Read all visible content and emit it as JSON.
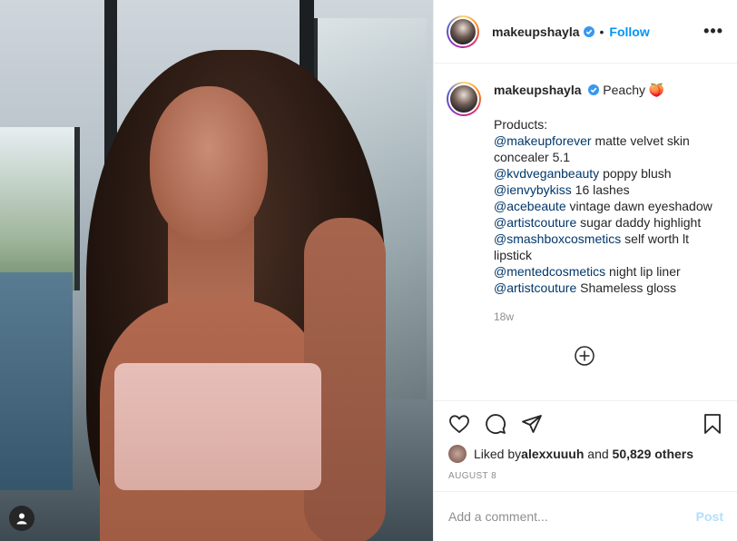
{
  "post": {
    "username": "makeupshayla",
    "follow_label": "Follow",
    "separator": "•",
    "more_label": "•••",
    "caption_title": "Peachy 🍑",
    "products_heading": "Products:",
    "product_lines": [
      {
        "mention": "@makeupforever",
        "text": " matte velvet skin concealer 5.1"
      },
      {
        "mention": "@kvdveganbeauty",
        "text": " poppy blush"
      },
      {
        "mention": "@ienvybykiss",
        "text": " 16 lashes"
      },
      {
        "mention": "@acebeaute",
        "text": " vintage dawn eyeshadow"
      },
      {
        "mention": "@artistcouture",
        "text": " sugar daddy highlight"
      },
      {
        "mention": "@smashboxcosmetics",
        "text": " self worth lt lipstick"
      },
      {
        "mention": "@mentedcosmetics",
        "text": " night lip liner"
      },
      {
        "mention": "@artistcouture",
        "text": " Shameless gloss"
      }
    ],
    "age": "18w",
    "liked_by_prefix": "Liked by ",
    "liked_by_user": "alexxuuuh",
    "liked_by_mid": " and ",
    "liked_by_count": "50,829 others",
    "date": "AUGUST 8",
    "comment_placeholder": "Add a comment...",
    "post_label": "Post"
  },
  "colors": {
    "accent": "#0095f6",
    "mention": "#00376b",
    "muted": "#8e8e8e",
    "verified": "#3897f0"
  }
}
